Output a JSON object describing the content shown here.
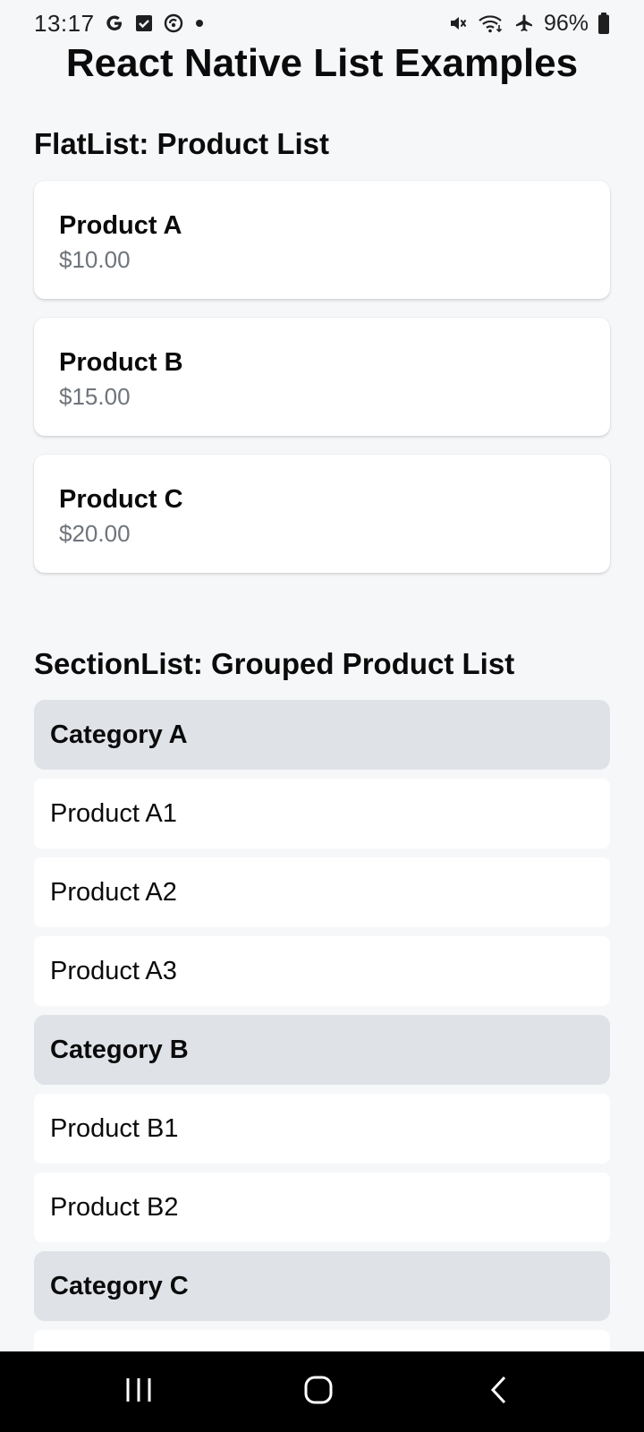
{
  "status_bar": {
    "time": "13:17",
    "left_icons": [
      "google-g-icon",
      "check-square-icon",
      "refresh-badge-icon",
      "notification-dot-icon"
    ],
    "right_icons": [
      "mute-icon",
      "wifi-icon",
      "airplane-mode-icon",
      "battery-icon"
    ],
    "battery_text": "96%"
  },
  "page": {
    "title": "React Native List Examples"
  },
  "flatlist": {
    "title": "FlatList: Product List",
    "items": [
      {
        "name": "Product A",
        "price": "$10.00"
      },
      {
        "name": "Product B",
        "price": "$15.00"
      },
      {
        "name": "Product C",
        "price": "$20.00"
      }
    ]
  },
  "sectionlist": {
    "title": "SectionList: Grouped Product List",
    "sections": [
      {
        "header": "Category A",
        "items": [
          "Product A1",
          "Product A2",
          "Product A3"
        ]
      },
      {
        "header": "Category B",
        "items": [
          "Product B1",
          "Product B2"
        ]
      },
      {
        "header": "Category C",
        "items": []
      }
    ]
  },
  "nav_bar": {
    "buttons": [
      "recent-apps-icon",
      "home-icon",
      "back-icon"
    ]
  },
  "colors": {
    "background": "#F6F7F9",
    "card": "#FFFFFF",
    "section_header": "#DFE2E7",
    "price_text": "#6F747B",
    "nav_bar": "#000000"
  }
}
